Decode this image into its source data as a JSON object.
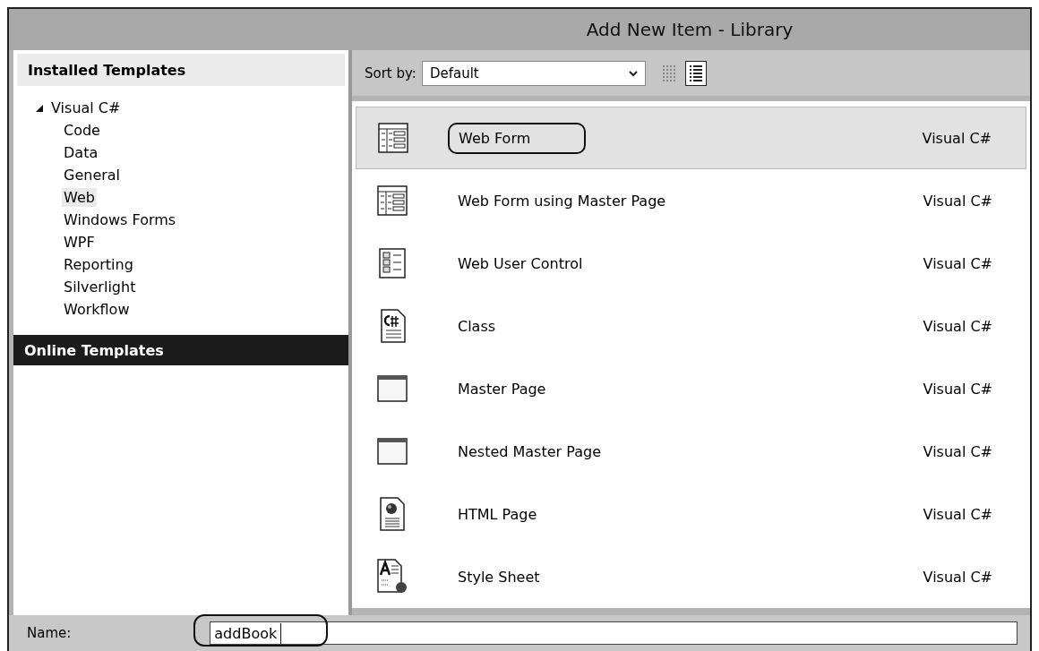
{
  "window": {
    "title": "Add New Item - Library"
  },
  "sidebar": {
    "installed_header": "Installed Templates",
    "tree": [
      {
        "label": "Visual C#",
        "expanded": true,
        "selected": false,
        "children": [
          {
            "label": "Code",
            "selected": false
          },
          {
            "label": "Data",
            "selected": false
          },
          {
            "label": "General",
            "selected": false
          },
          {
            "label": "Web",
            "selected": true
          },
          {
            "label": "Windows Forms",
            "selected": false
          },
          {
            "label": "WPF",
            "selected": false
          },
          {
            "label": "Reporting",
            "selected": false
          },
          {
            "label": "Silverlight",
            "selected": false
          },
          {
            "label": "Workflow",
            "selected": false
          }
        ]
      }
    ],
    "online_header": "Online Templates"
  },
  "toolbar": {
    "sort_label": "Sort by:",
    "sort_value": "Default",
    "views": [
      {
        "kind": "small",
        "selected": false
      },
      {
        "kind": "list",
        "selected": true
      }
    ]
  },
  "items": [
    {
      "kind": "webform",
      "name": "Web Form",
      "language": "Visual C#",
      "selected": true,
      "circled": true
    },
    {
      "kind": "webform",
      "name": "Web Form using Master Page",
      "language": "Visual C#",
      "selected": false,
      "circled": false
    },
    {
      "kind": "usercontrol",
      "name": "Web User Control",
      "language": "Visual C#",
      "selected": false,
      "circled": false
    },
    {
      "kind": "class",
      "name": "Class",
      "language": "Visual C#",
      "selected": false,
      "circled": false
    },
    {
      "kind": "masterpage",
      "name": "Master Page",
      "language": "Visual C#",
      "selected": false,
      "circled": false
    },
    {
      "kind": "masterpage",
      "name": "Nested Master Page",
      "language": "Visual C#",
      "selected": false,
      "circled": false
    },
    {
      "kind": "html",
      "name": "HTML Page",
      "language": "Visual C#",
      "selected": false,
      "circled": false
    },
    {
      "kind": "stylesheet",
      "name": "Style Sheet",
      "language": "Visual C#",
      "selected": false,
      "circled": false
    }
  ],
  "name_bar": {
    "label": "Name:",
    "value": "addBook",
    "circled": true
  }
}
